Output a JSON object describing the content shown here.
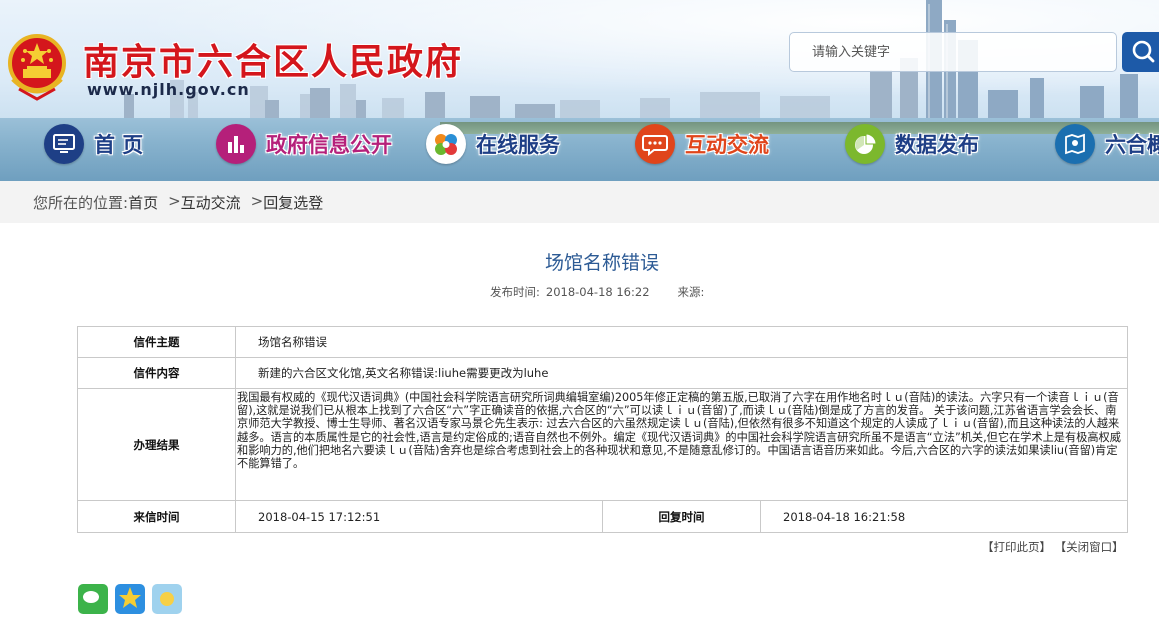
{
  "header": {
    "site_title": "南京市六合区人民政府",
    "site_url": "www.njlh.gov.cn",
    "search_placeholder": "请输入关键字"
  },
  "nav": {
    "items": [
      {
        "label": "首 页",
        "icon": "monitor-icon",
        "color": "#1e3f86"
      },
      {
        "label": "政府信息公开",
        "icon": "chart-bar-icon",
        "color": "#b5207a"
      },
      {
        "label": "在线服务",
        "icon": "pinwheel-icon",
        "color": "#ffffff"
      },
      {
        "label": "互动交流",
        "icon": "chat-icon",
        "color": "#e0451b"
      },
      {
        "label": "数据发布",
        "icon": "pie-chart-icon",
        "color": "#7cb82d"
      },
      {
        "label": "六合概",
        "icon": "map-icon",
        "color": "#1b6fb0"
      }
    ]
  },
  "breadcrumb": {
    "prefix": "您所在的位置:",
    "items": [
      "首页",
      "互动交流",
      "回复选登"
    ],
    "separator": ">"
  },
  "article": {
    "title": "场馆名称错误",
    "publish_label": "发布时间:",
    "publish_time": "2018-04-18 16:22",
    "source_label": "来源:",
    "source": ""
  },
  "letter": {
    "subject_label": "信件主题",
    "subject": "场馆名称错误",
    "content_label": "信件内容",
    "content": "新建的六合区文化馆,英文名称错误:liuhe需要更改为luhe",
    "result_label": "办理结果",
    "result": "我国最有权威的《现代汉语词典》(中国社会科学院语言研究所词典编辑室编)2005年修正定稿的第五版,已取消了六字在用作地名时ｌｕ(音陆)的读法。六字只有一个读音ｌｉｕ(音留),这就是说我们已从根本上找到了六合区“六”字正确读音的依据,六合区的“六”可以读ｌｉｕ(音留)了,而读ｌｕ(音陆)倒是成了方言的发音。  关于该问题,江苏省语言学会会长、南京师范大学教授、博士生导师、著名汉语专家马景仑先生表示:  过去六合区的六虽然规定读ｌｕ(音陆),但依然有很多不知道这个规定的人读成了ｌｉｕ(音留),而且这种读法的人越来越多。语言的本质属性是它的社会性,语言是约定俗成的;语音自然也不例外。编定《现代汉语词典》的中国社会科学院语言研究所虽不是语言“立法”机关,但它在学术上是有极高权威和影响力的,他们把地名六要读ｌｕ(音陆)舍弃也是综合考虑到社会上的各种现状和意见,不是随意乱修订的。中国语言语音历来如此。今后,六合区的六字的读法如果读liu(音留)肯定不能算错了。",
    "received_label": "来信时间",
    "received_time": "2018-04-15 17:12:51",
    "reply_label": "回复时间",
    "reply_time": "2018-04-18 16:21:58"
  },
  "actions": {
    "print": "【打印此页】",
    "close": "【关闭窗口】"
  },
  "colors": {
    "title_red": "#d4161c",
    "article_title_blue": "#2d5b95",
    "search_button": "#1d5aa8"
  }
}
